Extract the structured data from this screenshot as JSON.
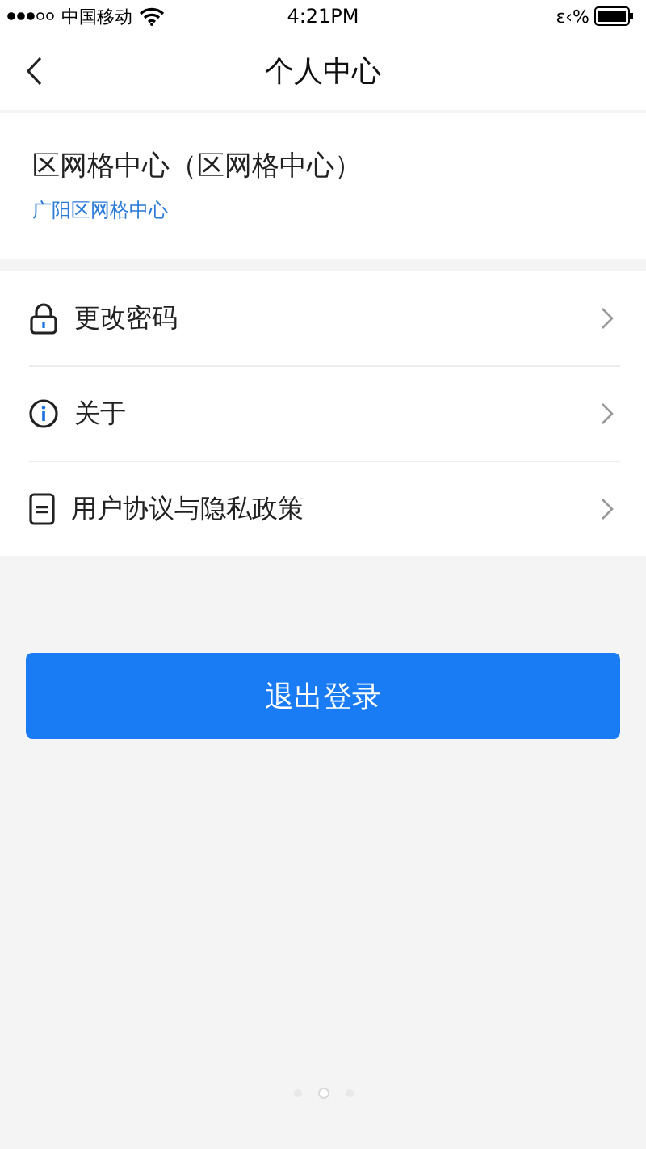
{
  "status_bar": {
    "carrier": "中国移动",
    "time": "4:21PM",
    "battery_text": "ɛ‹%"
  },
  "nav": {
    "title": "个人中心"
  },
  "profile": {
    "name": "区网格中心（区网格中心）",
    "org": "广阳区网格中心"
  },
  "menu": [
    {
      "kind": "lock",
      "label": "更改密码"
    },
    {
      "kind": "info",
      "label": "关于"
    },
    {
      "kind": "doc",
      "label": "用户协议与隐私政策"
    }
  ],
  "logout_button": "退出登录",
  "page_dots": [
    {
      "selected": false
    },
    {
      "selected": true
    },
    {
      "selected": false
    }
  ]
}
